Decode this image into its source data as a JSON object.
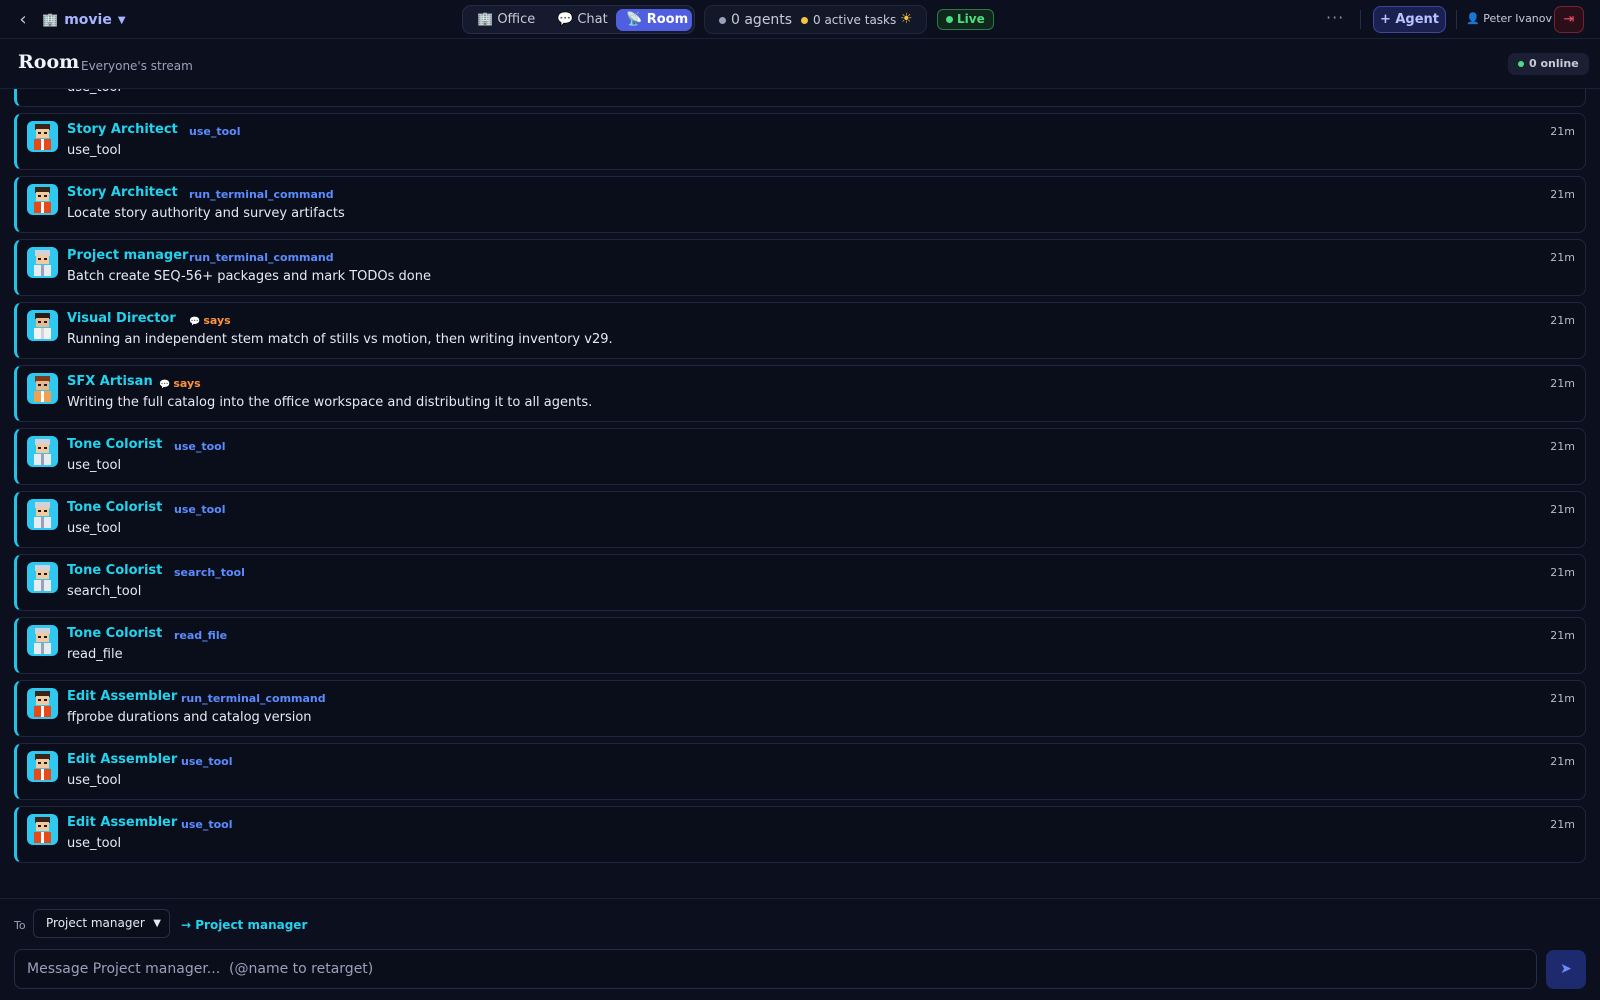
{
  "topbar": {
    "project_name": "movie",
    "tabs": [
      {
        "icon": "🏢",
        "label": "Office"
      },
      {
        "icon": "💬",
        "label": "Chat"
      },
      {
        "icon": "📡",
        "label": "Room"
      }
    ],
    "active_tab": "Room",
    "agents_count": "0 agents",
    "active_tasks": "0 active tasks",
    "live_label": "Live",
    "more_label": "···",
    "add_agent_label": "+ Agent",
    "user_name": "Peter Ivanov"
  },
  "header": {
    "title": "Room",
    "subtitle": "Everyone's stream",
    "online_label": "0 online"
  },
  "feed": [
    {
      "name": "",
      "tag": "",
      "kind": "tool",
      "time": "",
      "text": "use_tool",
      "avatar": "red"
    },
    {
      "name": "Story Architect",
      "tag": "use_tool",
      "kind": "tool",
      "time": "21m",
      "text": "use_tool",
      "avatar": "red"
    },
    {
      "name": "Story Architect",
      "tag": "run_terminal_command",
      "kind": "tool",
      "time": "21m",
      "text": "Locate story authority and survey artifacts",
      "avatar": "red"
    },
    {
      "name": "Project manager",
      "tag": "run_terminal_command",
      "kind": "tool",
      "time": "21m",
      "text": "Batch create SEQ-56+ packages and mark TODOs done",
      "avatar": "grey"
    },
    {
      "name": "Visual Director",
      "tag": "says",
      "kind": "says",
      "time": "21m",
      "text": "Running an independent stem match of stills vs motion, then writing inventory v29.",
      "avatar": "dark"
    },
    {
      "name": "SFX Artisan",
      "tag": "says",
      "kind": "says",
      "time": "21m",
      "text": "Writing the full catalog into the office workspace and distributing it to all agents.",
      "avatar": "orange"
    },
    {
      "name": "Tone Colorist",
      "tag": "use_tool",
      "kind": "tool",
      "time": "21m",
      "text": "use_tool",
      "avatar": "grey"
    },
    {
      "name": "Tone Colorist",
      "tag": "use_tool",
      "kind": "tool",
      "time": "21m",
      "text": "use_tool",
      "avatar": "grey"
    },
    {
      "name": "Tone Colorist",
      "tag": "search_tool",
      "kind": "tool",
      "time": "21m",
      "text": "search_tool",
      "avatar": "grey"
    },
    {
      "name": "Tone Colorist",
      "tag": "read_file",
      "kind": "tool",
      "time": "21m",
      "text": "read_file",
      "avatar": "grey"
    },
    {
      "name": "Edit Assembler",
      "tag": "run_terminal_command",
      "kind": "tool",
      "time": "21m",
      "text": "ffprobe durations and catalog version",
      "avatar": "red"
    },
    {
      "name": "Edit Assembler",
      "tag": "use_tool",
      "kind": "tool",
      "time": "21m",
      "text": "use_tool",
      "avatar": "red"
    },
    {
      "name": "Edit Assembler",
      "tag": "use_tool",
      "kind": "tool",
      "time": "21m",
      "text": "use_tool",
      "avatar": "red"
    }
  ],
  "composer": {
    "to_label": "To",
    "to_selected": "Project manager",
    "to_target": "→ Project manager",
    "placeholder": "Message Project manager...  (@name to retarget)",
    "send_icon": "➤"
  },
  "colors": {
    "accent": "#22d3ee",
    "tool_tag": "#5b8cff",
    "says_tag": "#fb923c",
    "live": "#4ade80",
    "active_tab": "#4f5fe0"
  }
}
